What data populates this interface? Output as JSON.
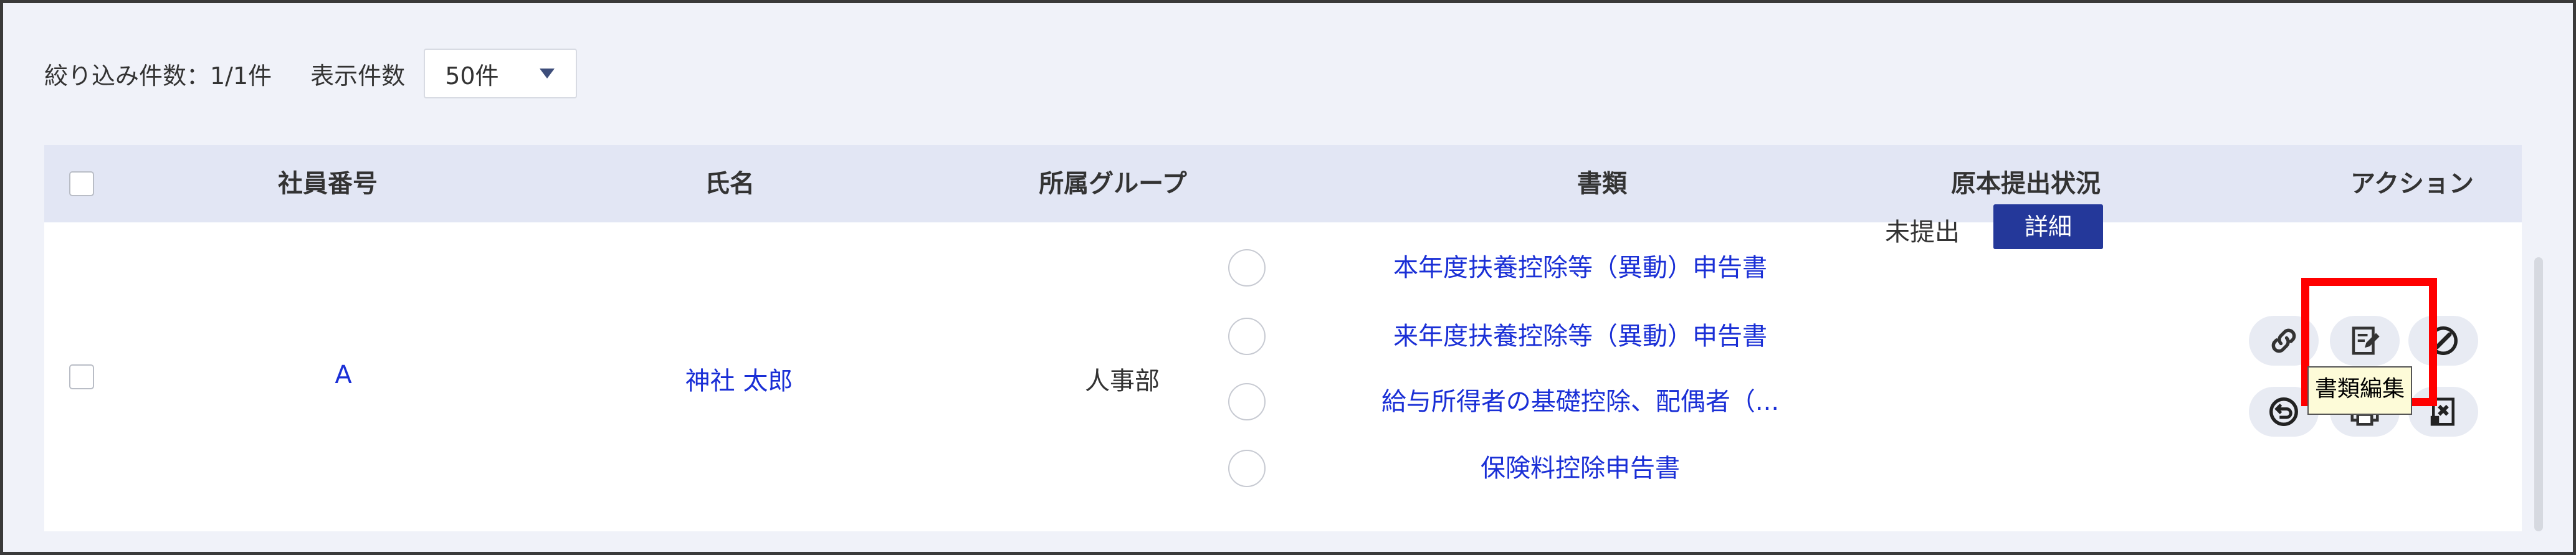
{
  "toolbar": {
    "filter_count": "絞り込み件数：1/1件",
    "per_page_label": "表示件数",
    "per_page_value": "50件"
  },
  "table": {
    "headers": {
      "employee_number": "社員番号",
      "name": "氏名",
      "group": "所属グループ",
      "documents": "書類",
      "original_status": "原本提出状況",
      "action": "アクション"
    },
    "row": {
      "employee_number": "A",
      "name": "神社 太郎",
      "group": "人事部",
      "documents": [
        "本年度扶養控除等（異動）申告書",
        "来年度扶養控除等（異動）申告書",
        "給与所得者の基礎控除、配偶者（...",
        "保険料控除申告書"
      ],
      "status": "未提出",
      "detail_button": "詳細"
    },
    "action_icons": [
      "link-icon",
      "edit-document-icon",
      "cancel-icon",
      "undo-icon",
      "print-icon",
      "delete-document-icon"
    ]
  },
  "tooltip": "書類編集",
  "colors": {
    "background": "#f0f2f9",
    "header_bg": "#e2e6f4",
    "link": "#1a2fd6",
    "primary_button": "#24389a",
    "highlight": "#ff0000",
    "tooltip_bg": "#fdfbd8"
  }
}
